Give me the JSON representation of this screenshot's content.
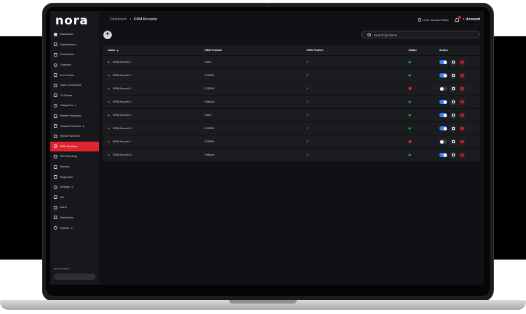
{
  "brand": {
    "logo_text": "nora",
    "accent": "#e0252f"
  },
  "header": {
    "breadcrumb": [
      "Dashboard",
      "DRM Accounts"
    ],
    "breadcrumb_sep": "•",
    "time": "11:06",
    "location": "Europe/Vilnius",
    "account_chevron": ">",
    "account_label": "Account"
  },
  "toolbar": {
    "add_label": "+",
    "search_placeholder": "Search by Name"
  },
  "sidebar": {
    "items": [
      {
        "label": "Dashboard",
        "icon": "grid-icon"
      },
      {
        "label": "Organizations",
        "icon": "building-icon"
      },
      {
        "label": "Subscribers",
        "icon": "user-icon"
      },
      {
        "label": "Channels",
        "icon": "film-icon"
      },
      {
        "label": "Live Events",
        "icon": "live-icon"
      },
      {
        "label": "Video on Demand",
        "icon": "video-icon"
      },
      {
        "label": "TV Shows",
        "icon": "tv-icon"
      },
      {
        "label": "Categories",
        "icon": "plus-circle-icon",
        "caret": "▸"
      },
      {
        "label": "Partner Programs",
        "icon": "handshake-icon"
      },
      {
        "label": "Channel Services",
        "icon": "tools-icon",
        "caret": "▸"
      },
      {
        "label": "Stream Services",
        "icon": "stream-icon"
      },
      {
        "label": "DRM Services",
        "icon": "shield-icon",
        "active": true
      },
      {
        "label": "GEO Blocking",
        "icon": "globe-icon"
      },
      {
        "label": "Devices",
        "icon": "device-icon"
      },
      {
        "label": "Fingerprint",
        "icon": "fingerprint-icon"
      },
      {
        "label": "Settings",
        "icon": "gear-icon",
        "caret": "▸"
      },
      {
        "label": "Info",
        "icon": "info-icon"
      },
      {
        "label": "Users",
        "icon": "users-icon"
      },
      {
        "label": "Distributors",
        "icon": "distributor-icon"
      },
      {
        "label": "Reports",
        "icon": "report-icon",
        "caret": "▸"
      }
    ],
    "quick_nav_label": "Quick Navigation"
  },
  "table": {
    "columns": {
      "name": "Name",
      "provider": "DRM Provider",
      "profiles": "DRM Profiles",
      "status": "Status",
      "action": "Action"
    },
    "sort_indicator": "▾",
    "expander": "▸",
    "rows": [
      {
        "name": "DRM Account 1",
        "provider": "irdeto",
        "profiles": "1",
        "status": "running",
        "enabled": true
      },
      {
        "name": "DRM Account 2",
        "provider": "EZDRM",
        "profiles": "2",
        "status": "running",
        "enabled": true
      },
      {
        "name": "DRM Account 3",
        "provider": "EZDRM",
        "profiles": "4",
        "status": "stopped",
        "enabled": false
      },
      {
        "name": "DRM Account 4",
        "provider": "Pallycon",
        "profiles": "1",
        "status": "running",
        "enabled": true
      },
      {
        "name": "DRM Account 5",
        "provider": "irdeto",
        "profiles": "1",
        "status": "running",
        "enabled": true
      },
      {
        "name": "DRM Account 6",
        "provider": "EZDRM",
        "profiles": "2",
        "status": "running",
        "enabled": true
      },
      {
        "name": "DRM Account 7",
        "provider": "EZDRM",
        "profiles": "4",
        "status": "stopped",
        "enabled": false
      },
      {
        "name": "DRM Account 8",
        "provider": "Pallycon",
        "profiles": "1",
        "status": "running",
        "enabled": true
      }
    ]
  },
  "colors": {
    "status_running": "#1bbf3a",
    "status_stopped": "#e0252f",
    "toggle_on": "#3b82f6"
  }
}
